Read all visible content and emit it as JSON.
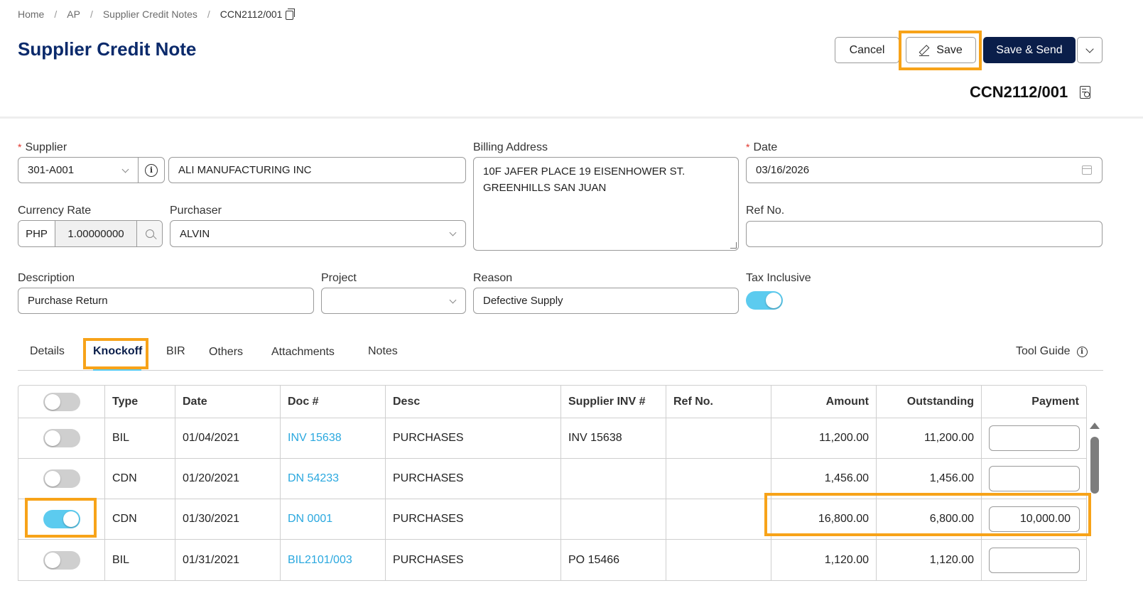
{
  "breadcrumb": {
    "items": [
      "Home",
      "AP",
      "Supplier Credit Notes"
    ],
    "current": "CCN2112/001"
  },
  "header": {
    "title": "Supplier Credit Note",
    "doc_number": "CCN2112/001",
    "cancel_label": "Cancel",
    "save_label": "Save",
    "save_send_label": "Save & Send"
  },
  "form": {
    "supplier": {
      "label": "Supplier",
      "code": "301-A001",
      "name": "ALI MANUFACTURING INC"
    },
    "billing_address": {
      "label": "Billing Address",
      "line1": "10F JAFER PLACE 19 EISENHOWER ST.",
      "line2": "GREENHILLS SAN JUAN"
    },
    "date": {
      "label": "Date",
      "value": "03/16/2026"
    },
    "currency_rate": {
      "label": "Currency Rate",
      "code": "PHP",
      "rate": "1.00000000"
    },
    "purchaser": {
      "label": "Purchaser",
      "value": "ALVIN"
    },
    "ref_no": {
      "label": "Ref No.",
      "value": ""
    },
    "description": {
      "label": "Description",
      "value": "Purchase Return"
    },
    "project": {
      "label": "Project",
      "value": ""
    },
    "reason": {
      "label": "Reason",
      "value": "Defective Supply"
    },
    "tax_inclusive": {
      "label": "Tax Inclusive",
      "on": true
    }
  },
  "tabs": {
    "items": [
      "Details",
      "Knockoff",
      "BIR",
      "Others",
      "Attachments",
      "Notes"
    ],
    "active": "Knockoff",
    "tool_guide": "Tool Guide"
  },
  "table": {
    "columns": [
      "Type",
      "Date",
      "Doc #",
      "Desc",
      "Supplier INV #",
      "Ref No.",
      "Amount",
      "Outstanding",
      "Payment"
    ],
    "rows": [
      {
        "selected": false,
        "type": "BIL",
        "date": "01/04/2021",
        "doc": "INV 15638",
        "desc": "PURCHASES",
        "supplier_inv": "INV 15638",
        "ref_no": "",
        "amount": "11,200.00",
        "outstanding": "11,200.00",
        "payment": ""
      },
      {
        "selected": false,
        "type": "CDN",
        "date": "01/20/2021",
        "doc": "DN 54233",
        "desc": "PURCHASES",
        "supplier_inv": "",
        "ref_no": "",
        "amount": "1,456.00",
        "outstanding": "1,456.00",
        "payment": ""
      },
      {
        "selected": true,
        "type": "CDN",
        "date": "01/30/2021",
        "doc": "DN 0001",
        "desc": "PURCHASES",
        "supplier_inv": "",
        "ref_no": "",
        "amount": "16,800.00",
        "outstanding": "6,800.00",
        "payment": "10,000.00"
      },
      {
        "selected": false,
        "type": "BIL",
        "date": "01/31/2021",
        "doc": "BIL2101/003",
        "desc": "PURCHASES",
        "supplier_inv": "PO 15466",
        "ref_no": "",
        "amount": "1,120.00",
        "outstanding": "1,120.00",
        "payment": ""
      }
    ]
  },
  "colors": {
    "brand_navy": "#0a1e4a",
    "title_blue": "#0b2a6b",
    "toggle_on": "#5ccbef",
    "link": "#2aa8df",
    "highlight": "#f7a319",
    "required": "#e0342b"
  }
}
